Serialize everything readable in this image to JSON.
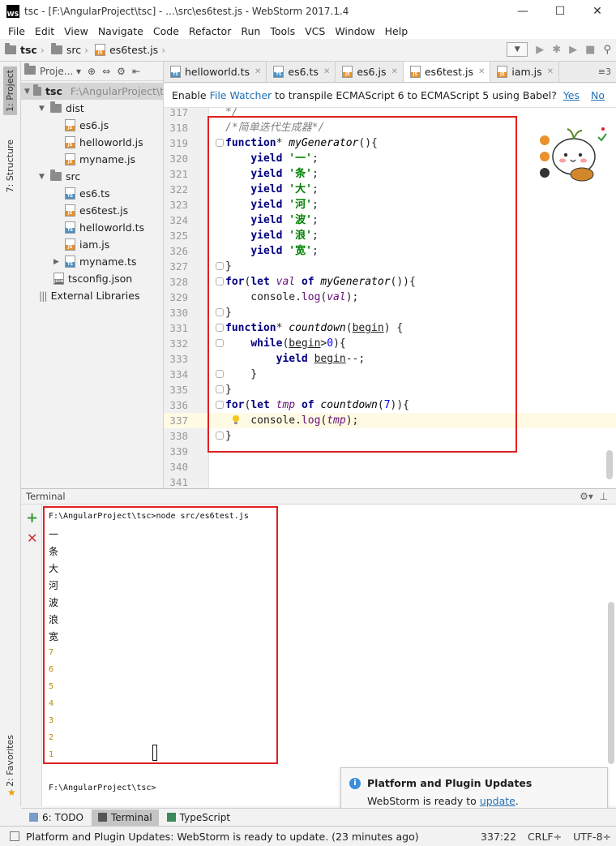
{
  "window": {
    "title": "tsc - [F:\\AngularProject\\tsc] - ...\\src\\es6test.js - WebStorm 2017.1.4",
    "logo": "WS",
    "minimize": "—",
    "maximize": "☐",
    "close": "✕"
  },
  "menu": [
    "File",
    "Edit",
    "View",
    "Navigate",
    "Code",
    "Refactor",
    "Run",
    "Tools",
    "VCS",
    "Window",
    "Help"
  ],
  "breadcrumb": [
    "tsc",
    "src",
    "es6test.js"
  ],
  "left_tools": {
    "project": "1: Project",
    "structure": "7: Structure",
    "favorites": "2: Favorites"
  },
  "project": {
    "header": "Proje...",
    "root": {
      "name": "tsc",
      "path": "F:\\AngularProject\\t"
    },
    "items": [
      {
        "label": "dist",
        "type": "folder",
        "expanded": true,
        "depth": 1
      },
      {
        "label": "es6.js",
        "type": "js",
        "depth": 2
      },
      {
        "label": "helloworld.js",
        "type": "js",
        "depth": 2
      },
      {
        "label": "myname.js",
        "type": "js",
        "depth": 2
      },
      {
        "label": "src",
        "type": "folder",
        "expanded": true,
        "depth": 1
      },
      {
        "label": "es6.ts",
        "type": "ts",
        "depth": 2
      },
      {
        "label": "es6test.js",
        "type": "js",
        "depth": 2
      },
      {
        "label": "helloworld.ts",
        "type": "ts",
        "depth": 2
      },
      {
        "label": "iam.js",
        "type": "js",
        "depth": 2
      },
      {
        "label": "myname.ts",
        "type": "ts",
        "depth": 2,
        "collapsed": true
      },
      {
        "label": "tsconfig.json",
        "type": "json",
        "depth": 1
      },
      {
        "label": "External Libraries",
        "type": "lib",
        "depth": 0
      }
    ]
  },
  "editor_tabs": [
    {
      "label": "helloworld.ts",
      "type": "ts",
      "active": false
    },
    {
      "label": "es6.ts",
      "type": "ts",
      "active": false
    },
    {
      "label": "es6.js",
      "type": "js",
      "active": false
    },
    {
      "label": "es6test.js",
      "type": "js",
      "active": true
    },
    {
      "label": "iam.js",
      "type": "js",
      "active": false
    }
  ],
  "editor_tabs_more": "≡3",
  "banner": {
    "prefix": "Enable ",
    "link": "File Watcher",
    "suffix": " to transpile ECMAScript 6 to ECMAScript 5 using Babel?",
    "yes": "Yes",
    "no": "No"
  },
  "code": {
    "caret_line": 337,
    "lines": [
      {
        "n": 317,
        "text": "*/"
      },
      {
        "n": 318,
        "text": "/*简单迭代生成器*/"
      },
      {
        "n": 319,
        "text": "function* myGenerator(){"
      },
      {
        "n": 320,
        "text": "    yield '一';"
      },
      {
        "n": 321,
        "text": "    yield '条';"
      },
      {
        "n": 322,
        "text": "    yield '大';"
      },
      {
        "n": 323,
        "text": "    yield '河';"
      },
      {
        "n": 324,
        "text": "    yield '波';"
      },
      {
        "n": 325,
        "text": "    yield '浪';"
      },
      {
        "n": 326,
        "text": "    yield '宽';"
      },
      {
        "n": 327,
        "text": "}"
      },
      {
        "n": 328,
        "text": "for(let val of myGenerator()){"
      },
      {
        "n": 329,
        "text": "    console.log(val);"
      },
      {
        "n": 330,
        "text": "}"
      },
      {
        "n": 331,
        "text": "function* countdown(begin) {"
      },
      {
        "n": 332,
        "text": "    while(begin>0){"
      },
      {
        "n": 333,
        "text": "        yield begin--;"
      },
      {
        "n": 334,
        "text": "    }"
      },
      {
        "n": 335,
        "text": "}"
      },
      {
        "n": 336,
        "text": "for(let tmp of countdown(7)){"
      },
      {
        "n": 337,
        "text": "    console.log(tmp);"
      },
      {
        "n": 338,
        "text": "}"
      },
      {
        "n": 339,
        "text": ""
      },
      {
        "n": 340,
        "text": ""
      },
      {
        "n": 341,
        "text": ""
      }
    ]
  },
  "terminal": {
    "title": "Terminal",
    "command": "F:\\AngularProject\\tsc>node src/es6test.js",
    "chars": [
      "一",
      "条",
      "大",
      "河",
      "波",
      "浪",
      "宽"
    ],
    "numbers": [
      "7",
      "6",
      "5",
      "4",
      "3",
      "2",
      "1"
    ],
    "prompt": "F:\\AngularProject\\tsc>"
  },
  "popup": {
    "title": "Platform and Plugin Updates",
    "body_prefix": "WebStorm is ready to ",
    "link": "update",
    "body_suffix": "."
  },
  "tool_tabs": [
    "6: TODO",
    "Terminal",
    "TypeScript"
  ],
  "status": {
    "message": "Platform and Plugin Updates: WebStorm is ready to update. (23 minutes ago)",
    "position": "337:22",
    "line_sep": "CRLF÷",
    "encoding": "UTF-8÷"
  },
  "colors": {
    "highlight_box": "#e02020",
    "keyword": "#000080",
    "string": "#008000",
    "link": "#2470b3"
  }
}
